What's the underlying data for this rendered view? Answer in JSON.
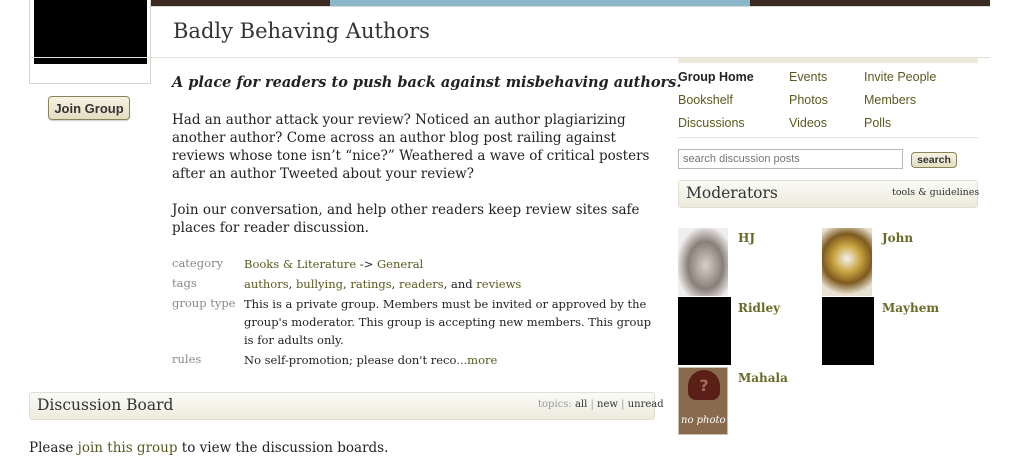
{
  "group": {
    "title": "Badly Behaving Authors",
    "join_label": "Join Group",
    "tagline": "A place for readers to push back against misbehaving authors.",
    "description_1": "Had an author attack your review? Noticed an author plagiarizing another author? Come across an author blog post railing against reviews whose tone isn’t “nice?” Weathered a wave of critical posters after an author Tweeted about your review?",
    "description_2": "Join our conversation, and help other readers keep review sites safe places for reader discussion."
  },
  "meta": {
    "category_label": "category",
    "category_main": "Books & Literature",
    "category_arrow": " -> ",
    "category_sub": "General",
    "tags_label": "tags",
    "tags": [
      "authors",
      "bullying",
      "ratings",
      "readers",
      "reviews"
    ],
    "tags_and": ", and ",
    "group_type_label": "group type",
    "group_type_value": "This is a private group. Members must be invited or approved by the group's moderator. This group is accepting new members. This group is for adults only.",
    "rules_label": "rules",
    "rules_value": "No self-promotion; please don't reco",
    "rules_more": "...more"
  },
  "discussion": {
    "title": "Discussion Board",
    "topics_label": "topics:",
    "topics_all": "all",
    "topics_new": "new",
    "topics_unread": "unread",
    "sep": "|",
    "note_prefix": "Please ",
    "note_link": "join this group",
    "note_suffix": " to view the discussion boards."
  },
  "nav": {
    "group_home": "Group Home",
    "events": "Events",
    "invite_people": "Invite People",
    "bookshelf": "Bookshelf",
    "photos": "Photos",
    "members": "Members",
    "discussions": "Discussions",
    "videos": "Videos",
    "polls": "Polls"
  },
  "search": {
    "placeholder": "search discussion posts",
    "button": "search"
  },
  "moderators": {
    "title": "Moderators",
    "tools": "tools & guidelines",
    "list": [
      {
        "name": "HJ"
      },
      {
        "name": "John"
      },
      {
        "name": "Ridley"
      },
      {
        "name": "Mayhem"
      },
      {
        "name": "Mahala",
        "photo_text": "no photo",
        "photo_glyph": "?"
      }
    ]
  },
  "colors": {
    "link": "#5a5a20",
    "button_bg": "#ece6cc",
    "bar_bg": "#f3f2e7"
  }
}
